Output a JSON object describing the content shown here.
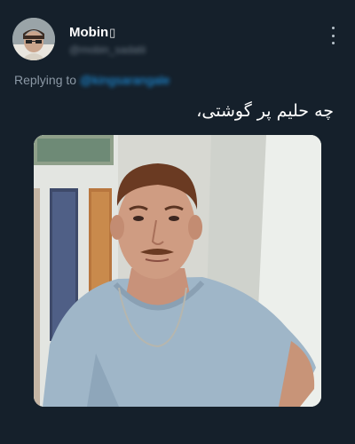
{
  "user": {
    "display_name": "Mobin",
    "badge_glyph": "▯",
    "handle": "@mobin_sadatii"
  },
  "reply": {
    "prefix": "Replying to",
    "mention": "@kingsarangale"
  },
  "tweet": {
    "text": "چه حلیم پر گوشتی،"
  },
  "menu": {
    "icon": "more-vertical-icon"
  },
  "colors": {
    "background": "#15202b",
    "accent": "#1d9bf0",
    "muted": "#8b98a5"
  }
}
